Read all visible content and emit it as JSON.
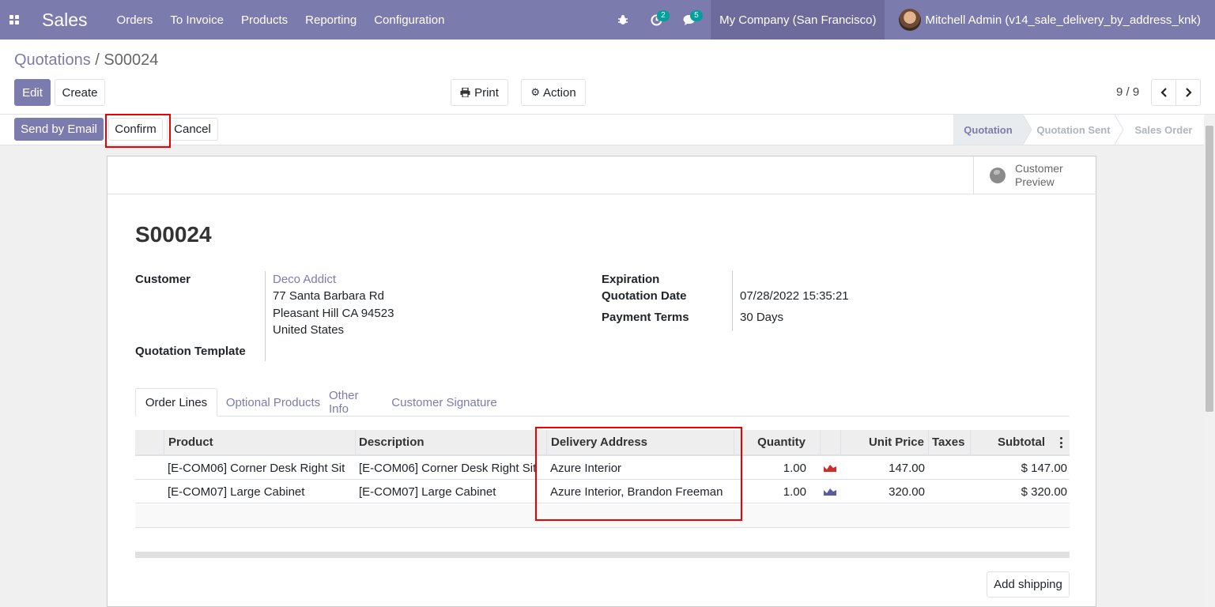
{
  "navbar": {
    "app_name": "Sales",
    "menu": [
      "Orders",
      "To Invoice",
      "Products",
      "Reporting",
      "Configuration"
    ],
    "activity_count": "2",
    "message_count": "5",
    "company": "My Company (San Francisco)",
    "user": "Mitchell Admin (v14_sale_delivery_by_address_knk)",
    "icons": [
      "apps-icon",
      "bug-icon",
      "clock-icon",
      "chat-icon"
    ]
  },
  "breadcrumb": {
    "parent": "Quotations",
    "separator": "/",
    "current": "S00024"
  },
  "toolbar": {
    "edit": "Edit",
    "create": "Create",
    "print": "Print",
    "action": "Action",
    "pager": "9 / 9"
  },
  "statusbar": {
    "send_email": "Send by Email",
    "confirm": "Confirm",
    "cancel": "Cancel",
    "stages": [
      "Quotation",
      "Quotation Sent",
      "Sales Order"
    ],
    "active_stage": "Quotation"
  },
  "sheet": {
    "preview_line1": "Customer",
    "preview_line2": "Preview",
    "title": "S00024",
    "customer_label": "Customer",
    "customer_name": "Deco Addict",
    "address1": "77 Santa Barbara Rd",
    "address2": "Pleasant Hill CA 94523",
    "address3": "United States",
    "template_label": "Quotation Template",
    "expiration_label": "Expiration",
    "quotation_date_label": "Quotation Date",
    "quotation_date": "07/28/2022 15:35:21",
    "payment_terms_label": "Payment Terms",
    "payment_terms": "30 Days"
  },
  "tabs": [
    "Order Lines",
    "Optional Products",
    "Other Info",
    "Customer Signature"
  ],
  "table": {
    "headers": {
      "product": "Product",
      "description": "Description",
      "delivery": "Delivery Address",
      "quantity": "Quantity",
      "unit_price": "Unit Price",
      "taxes": "Taxes",
      "subtotal": "Subtotal"
    },
    "rows": [
      {
        "product": "[E-COM06] Corner Desk Right Sit",
        "description": "[E-COM06] Corner Desk Right Sit",
        "delivery": "Azure Interior",
        "quantity": "1.00",
        "unit_price": "147.00",
        "taxes": "",
        "subtotal": "$ 147.00"
      },
      {
        "product": "[E-COM07] Large Cabinet",
        "description": "[E-COM07] Large Cabinet",
        "delivery": "Azure Interior, Brandon Freeman",
        "quantity": "1.00",
        "unit_price": "320.00",
        "taxes": "",
        "subtotal": "$ 320.00"
      }
    ]
  },
  "add_shipping": "Add shipping",
  "colors": {
    "brand": "#7c7bad",
    "highlight": "#e00000",
    "forecast_red": "#c9302c",
    "forecast_blue": "#5b5b9f"
  }
}
